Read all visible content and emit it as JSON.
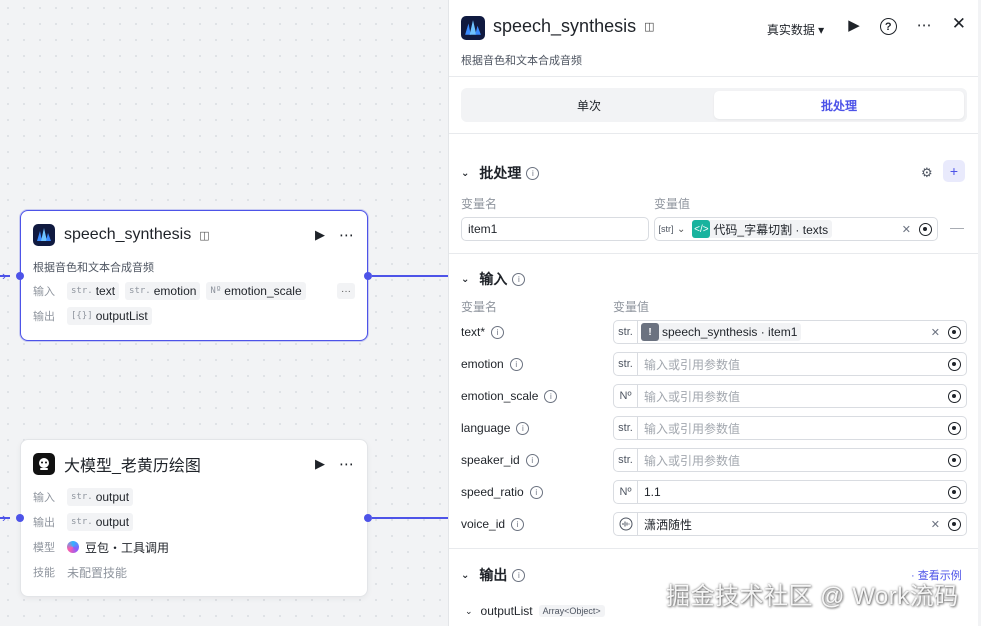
{
  "colors": {
    "accent": "#4d53e8",
    "canvas": "#f2f3f5"
  },
  "node1": {
    "title": "speech_synthesis",
    "desc": "根据音色和文本合成音频",
    "input_label": "输入",
    "output_label": "输出",
    "inputs": [
      {
        "type": "str.",
        "name": "text"
      },
      {
        "type": "str.",
        "name": "emotion"
      },
      {
        "type": "Nº",
        "name": "emotion_scale"
      }
    ],
    "more": "···",
    "output": {
      "type": "[{}]",
      "name": "outputList"
    }
  },
  "node2": {
    "title": "大模型_老黄历绘图",
    "input_label": "输入",
    "output_label": "输出",
    "model_label": "模型",
    "skill_label": "技能",
    "input": {
      "type": "str.",
      "name": "output"
    },
    "output": {
      "type": "str.",
      "name": "output"
    },
    "model": "豆包・工具调用",
    "skill": "未配置技能"
  },
  "panel": {
    "title": "speech_synthesis",
    "desc": "根据音色和文本合成音频",
    "data_mode": "真实数据 ▾",
    "tabs": [
      "单次",
      "批处理"
    ],
    "batch": {
      "title": "批处理",
      "col_name": "变量名",
      "col_value": "变量值",
      "var_name": "item1",
      "var_type": "[str]",
      "ref_text": "代码_字幕切割 · texts"
    },
    "input": {
      "title": "输入",
      "col_name": "变量名",
      "col_value": "变量值",
      "fields": [
        {
          "label": "text*",
          "type": "str.",
          "ref": "speech_synthesis · item1"
        },
        {
          "label": "emotion",
          "type": "str.",
          "placeholder": "输入或引用参数值"
        },
        {
          "label": "emotion_scale",
          "type": "Nº",
          "placeholder": "输入或引用参数值"
        },
        {
          "label": "language",
          "type": "str.",
          "placeholder": "输入或引用参数值"
        },
        {
          "label": "speaker_id",
          "type": "str.",
          "placeholder": "输入或引用参数值"
        },
        {
          "label": "speed_ratio",
          "type": "Nº",
          "value": "1.1"
        },
        {
          "label": "voice_id",
          "type": "",
          "value": "潇洒随性"
        }
      ]
    },
    "output": {
      "title": "输出",
      "view_example": "· 查看示例",
      "item": "outputList",
      "item_type": "Array<Object>"
    }
  },
  "watermark": "掘金技术社区 @ Work流码"
}
